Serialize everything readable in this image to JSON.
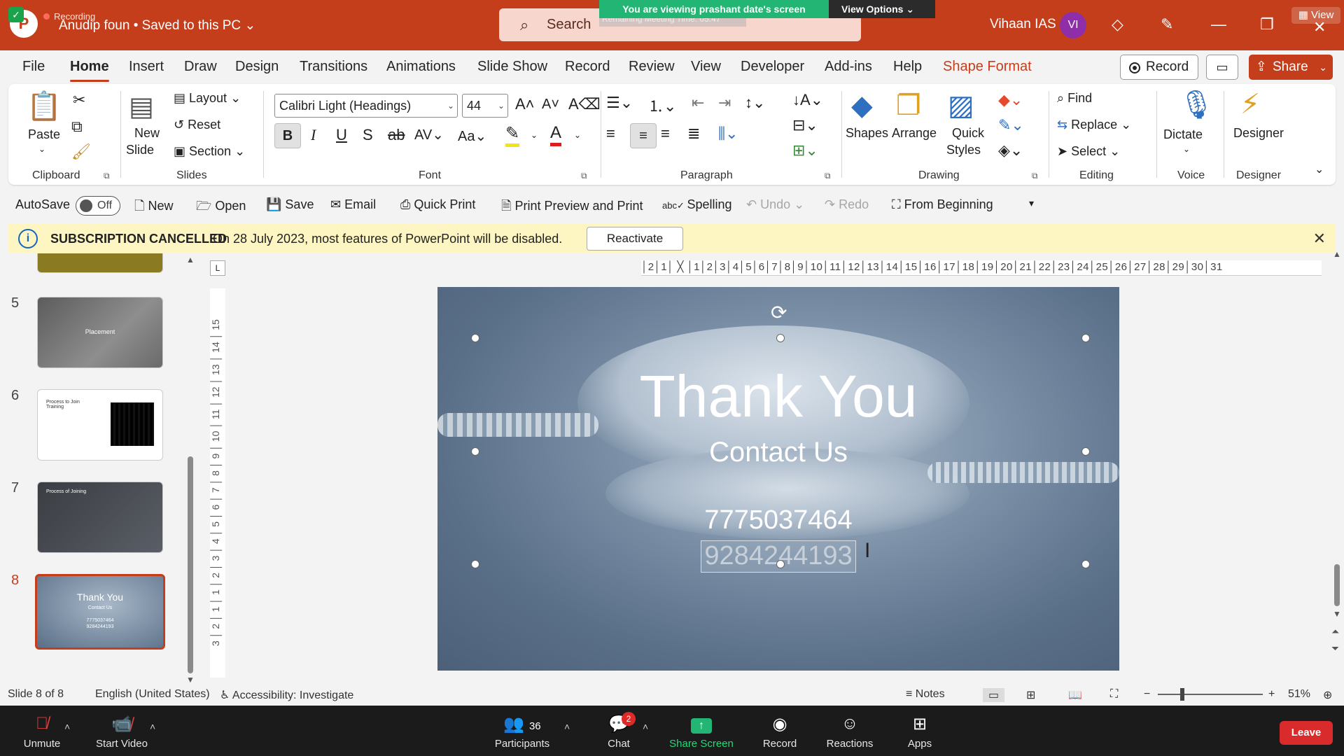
{
  "titlebar": {
    "recording_label": "Recording",
    "filename": "Anudip foun • Saved to this PC ⌄",
    "search_placeholder": "Search",
    "remaining_label": "Remaining Meeting Time: 05:47",
    "viewing_banner": "You are viewing prashant date's screen",
    "view_options": "View Options ⌄",
    "user_name": "Vihaan IAS",
    "avatar_initials": "VI",
    "view_label": "View"
  },
  "menu": {
    "tabs": [
      "File",
      "Home",
      "Insert",
      "Draw",
      "Design",
      "Transitions",
      "Animations",
      "Slide Show",
      "Record",
      "Review",
      "View",
      "Developer",
      "Add-ins",
      "Help",
      "Shape Format"
    ],
    "active_tab": "Home",
    "record_button": "Record",
    "share_button": "Share"
  },
  "ribbon": {
    "clipboard": {
      "paste": "Paste",
      "group": "Clipboard"
    },
    "slides": {
      "new_slide": "New",
      "new_slide2": "Slide",
      "layout": "Layout",
      "reset": "Reset",
      "section": "Section",
      "group": "Slides"
    },
    "font": {
      "font_name": "Calibri Light (Headings)",
      "font_size": "44",
      "group": "Font"
    },
    "paragraph": {
      "group": "Paragraph"
    },
    "drawing": {
      "shapes": "Shapes",
      "arrange": "Arrange",
      "quick_styles": "Quick",
      "quick_styles2": "Styles",
      "group": "Drawing"
    },
    "editing": {
      "find": "Find",
      "replace": "Replace",
      "select": "Select",
      "group": "Editing"
    },
    "voice": {
      "dictate": "Dictate",
      "group": "Voice"
    },
    "designer": {
      "designer": "Designer",
      "group": "Designer"
    }
  },
  "qat": {
    "autosave": "AutoSave",
    "autosave_state": "Off",
    "new": "New",
    "open": "Open",
    "save": "Save",
    "email": "Email",
    "quick_print": "Quick Print",
    "print_preview": "Print Preview and Print",
    "spelling": "Spelling",
    "undo": "Undo",
    "redo": "Redo",
    "from_beginning": "From Beginning"
  },
  "notice": {
    "title": "SUBSCRIPTION CANCELLED",
    "message": "On 28 July 2023, most features of PowerPoint will be disabled.",
    "button": "Reactivate"
  },
  "thumbnails": [
    {
      "num": "5",
      "label": "Placement"
    },
    {
      "num": "6",
      "label": "Process to Join Training"
    },
    {
      "num": "7",
      "label": "Process of Joining"
    },
    {
      "num": "8",
      "title": "Thank You",
      "sub": "Contact Us",
      "phone1": "7775037464",
      "phone2": "9284244193"
    }
  ],
  "ruler": {
    "horizontal": "│2│1│ ╳ │1│2│3│4│5│6│7│8│9│10│11│12│13│14│15│16│17│18│19│20│21│22│23│24│25│26│27│28│29│30│31",
    "vertical": "3 │ 2 │ 1 │ 1 │ 2 │ 3 │ 4 │ 5 │ 6 │ 7 │ 8 │ 9 │ 10 │ 11 │ 12 │ 13 │ 14 │ 15",
    "corner": "L"
  },
  "slide": {
    "title": "Thank You",
    "subtitle": "Contact Us",
    "phone1": "7775037464",
    "phone2": "9284244193"
  },
  "status": {
    "slide_count": "Slide 8 of 8",
    "language": "English (United States)",
    "accessibility": "Accessibility: Investigate",
    "notes": "Notes",
    "zoom": "51%"
  },
  "zoombar": {
    "unmute": "Unmute",
    "start_video": "Start Video",
    "participants": "Participants",
    "participants_count": "36",
    "chat": "Chat",
    "chat_badge": "2",
    "share_screen": "Share Screen",
    "record": "Record",
    "reactions": "Reactions",
    "apps": "Apps",
    "leave": "Leave"
  },
  "colors": {
    "brand": "#c43e1c",
    "zoom_green": "#22b573",
    "leave_red": "#d92b2b"
  }
}
